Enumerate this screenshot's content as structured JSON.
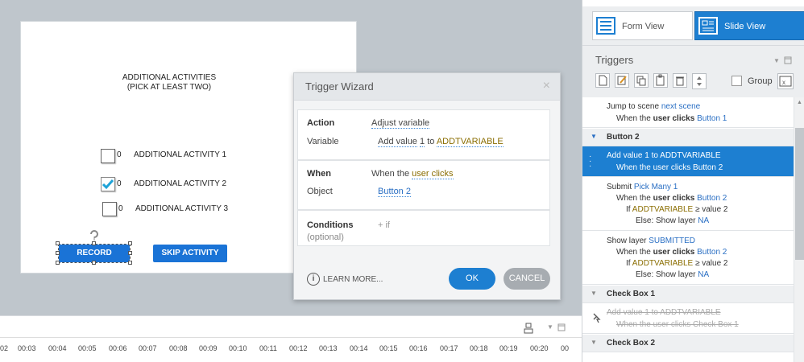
{
  "slide": {
    "title_line1": "ADDITIONAL ACTIVITIES",
    "title_line2": "(PICK AT LEAST TWO)",
    "activities": [
      {
        "num": "0",
        "label": "ADDITIONAL ACTIVITY 1",
        "checked": false
      },
      {
        "num": "0",
        "label": "ADDITIONAL ACTIVITY 2",
        "checked": true
      },
      {
        "num": "0",
        "label": "ADDITIONAL ACTIVITY 3",
        "checked": false
      }
    ],
    "record_button": "RECORD ACTIVITY",
    "skip_button": "SKIP ACTIVITY"
  },
  "dialog": {
    "title": "Trigger Wizard",
    "close": "×",
    "action_label": "Action",
    "action_value": "Adjust variable",
    "variable_label": "Variable",
    "variable_prefix": "Add value",
    "variable_amount": "1",
    "variable_to": "to",
    "variable_name": "ADDTVARIABLE",
    "when_label": "When",
    "when_prefix": "When the",
    "when_value": "user clicks",
    "object_label": "Object",
    "object_value": "Button 2",
    "conditions_label": "Conditions",
    "conditions_optional": "(optional)",
    "add_if": "+ if",
    "learn_more": "LEARN MORE...",
    "ok": "OK",
    "cancel": "CANCEL"
  },
  "timeline": {
    "ticks": [
      "02",
      "00:03",
      "00:04",
      "00:05",
      "00:06",
      "00:07",
      "00:08",
      "00:09",
      "00:10",
      "00:11",
      "00:12",
      "00:13",
      "00:14",
      "00:15",
      "00:16",
      "00:17",
      "00:18",
      "00:19",
      "00:20",
      "00"
    ]
  },
  "panel": {
    "form_view": "Form View",
    "slide_view": "Slide View",
    "triggers_title": "Triggers",
    "group_label": "Group",
    "rows": {
      "r1a": "Jump to scene",
      "r1b": "next scene",
      "r1c": "When the",
      "r1d": "user clicks",
      "r1e": "Button 1",
      "g_button2": "Button 2",
      "sel1": "Add value 1 to ADDTVARIABLE",
      "sel2": "When the user clicks Button 2",
      "s1": "Submit",
      "s1b": "Pick Many 1",
      "s2": "When the",
      "s2b": "user clicks",
      "s2c": "Button 2",
      "s3": "If",
      "s3b": "ADDTVARIABLE",
      "s3c": "≥ value 2",
      "s4": "Else: Show layer",
      "s4b": "NA",
      "l1": "Show layer",
      "l1b": "SUBMITTED",
      "l2": "When the",
      "l2b": "user clicks",
      "l2c": "Button 2",
      "l3": "If",
      "l3b": "ADDTVARIABLE",
      "l3c": "≥ value 2",
      "l4": "Else: Show layer",
      "l4b": "NA",
      "g_check1": "Check Box 1",
      "d1": "Add value 1 to ADDTVARIABLE",
      "d2": "When the user clicks Check Box 1",
      "g_check2": "Check Box 2"
    }
  },
  "colors": {
    "accent": "#1d7fd1",
    "link": "#2a6fc4",
    "variable": "#8a6d00"
  }
}
